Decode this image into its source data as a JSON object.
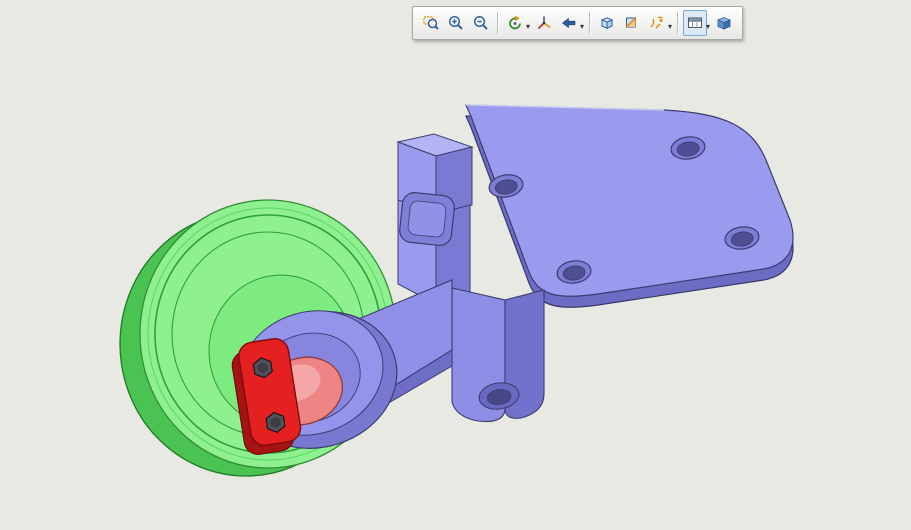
{
  "window": {
    "background": "#e9e9e4"
  },
  "toolbar": {
    "buttons": [
      {
        "icon": "zoom-to-area-icon"
      },
      {
        "icon": "zoom-in-icon"
      },
      {
        "icon": "zoom-out-icon"
      },
      {
        "icon": "rotate-view-icon"
      },
      {
        "icon": "axes-triad-icon"
      },
      {
        "icon": "previous-view-icon"
      },
      {
        "icon": "standard-views-icon"
      },
      {
        "icon": "section-view-icon"
      },
      {
        "icon": "sketch-entities-icon"
      },
      {
        "icon": "view-settings-icon"
      },
      {
        "icon": "shaded-with-edges-icon"
      }
    ],
    "pressed_button": "view-settings-icon"
  },
  "model": {
    "parts": [
      {
        "name": "mounting-bracket",
        "color": "#9a9aee"
      },
      {
        "name": "pulley-wheel",
        "color": "#8ef08e"
      },
      {
        "name": "retainer-plate",
        "color": "#e42020"
      },
      {
        "name": "shaft",
        "color": "#ee8484"
      },
      {
        "name": "hex-bolt",
        "color": "#52525c"
      }
    ]
  }
}
